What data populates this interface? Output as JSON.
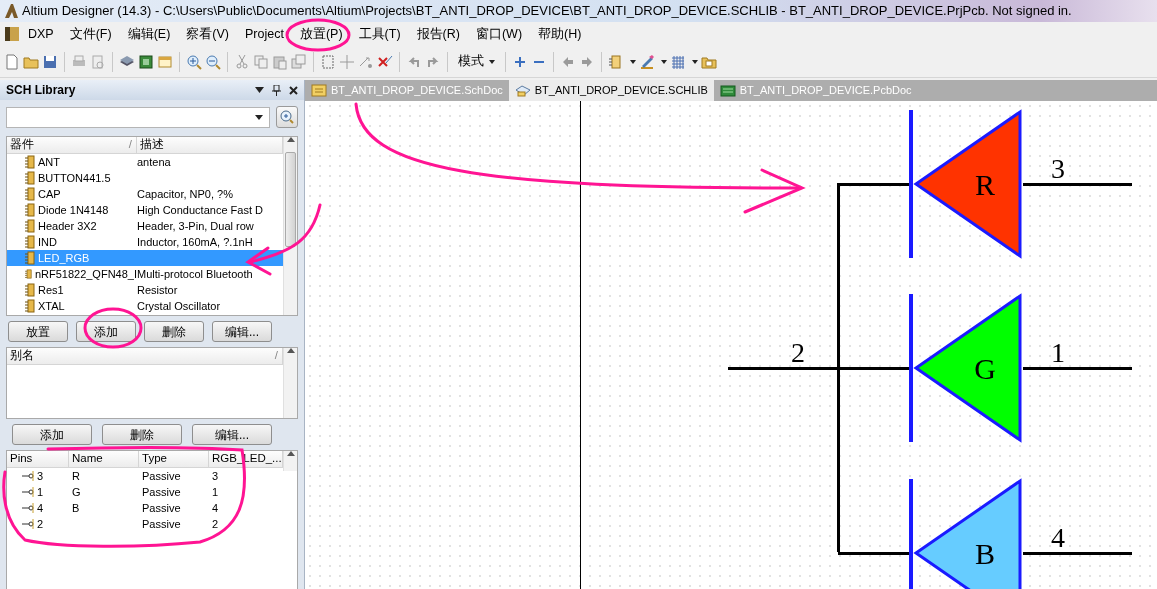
{
  "window": {
    "title": "Altium Designer (14.3) - C:\\Users\\Public\\Documents\\Altium\\Projects\\BT_ANTI_DROP_DEVICE\\BT_ANTI_DROP_DEVICE.SCHLIB - BT_ANTI_DROP_DEVICE.PrjPcb. Not signed in."
  },
  "menu": [
    "DXP",
    "文件(F)",
    "编辑(E)",
    "察看(V)",
    "Project",
    "放置(P)",
    "工具(T)",
    "报告(R)",
    "窗口(W)",
    "帮助(H)"
  ],
  "toolbar": {
    "mode_dropdown": "模式"
  },
  "panel": {
    "title": "SCH Library",
    "components": {
      "columns": [
        "器件",
        "描述"
      ],
      "sort_mark": "/",
      "rows": [
        {
          "name": "ANT",
          "description": "antena",
          "selected": false
        },
        {
          "name": "BUTTON441.5",
          "selected": false
        },
        {
          "name": "CAP",
          "description": "Capacitor, NP0, ?%",
          "selected": false
        },
        {
          "name": "Diode 1N4148",
          "description": "High Conductance Fast D",
          "selected": false
        },
        {
          "name": "Header 3X2",
          "description": "Header, 3-Pin, Dual row",
          "selected": false
        },
        {
          "name": "IND",
          "description": "Inductor, 160mA, ?.1nH",
          "selected": false
        },
        {
          "name": "LED_RGB",
          "selected": true
        },
        {
          "name": "nRF51822_QFN48_I",
          "description": "Multi-protocol Bluetooth",
          "selected": false
        },
        {
          "name": "Res1",
          "description": "Resistor",
          "selected": false
        },
        {
          "name": "XTAL",
          "description": "Crystal Oscillator",
          "selected": false
        }
      ]
    },
    "component_buttons": [
      "放置",
      "添加",
      "删除",
      "编辑..."
    ],
    "aliases": {
      "columns": [
        "别名"
      ],
      "sort_mark": "/"
    },
    "alias_buttons": [
      "添加",
      "删除",
      "编辑..."
    ],
    "pins": {
      "columns": [
        "Pins",
        "Name",
        "Type",
        "RGB_LED_..."
      ],
      "rows": [
        {
          "number": "3",
          "name": "R",
          "type": "Passive",
          "designator": "3"
        },
        {
          "number": "1",
          "name": "G",
          "type": "Passive",
          "designator": "1"
        },
        {
          "number": "4",
          "name": "B",
          "type": "Passive",
          "designator": "4"
        },
        {
          "number": "2",
          "type": "Passive",
          "designator": "2"
        }
      ]
    }
  },
  "tabs": [
    {
      "label": "BT_ANTI_DROP_DEVICE.SchDoc",
      "kind": "schdoc",
      "selected": false
    },
    {
      "label": "BT_ANTI_DROP_DEVICE.SCHLIB",
      "kind": "schlib",
      "selected": true
    },
    {
      "label": "BT_ANTI_DROP_DEVICE.PcbDoc",
      "kind": "pcbdoc",
      "selected": false
    }
  ],
  "schematic": {
    "diodes": [
      {
        "letter": "R",
        "color": "#ff3300",
        "pin": "3"
      },
      {
        "letter": "G",
        "color": "#00ff00",
        "pin": "1"
      },
      {
        "letter": "B",
        "color": "#66ccff",
        "pin": "4"
      }
    ],
    "common_pin": "2"
  }
}
